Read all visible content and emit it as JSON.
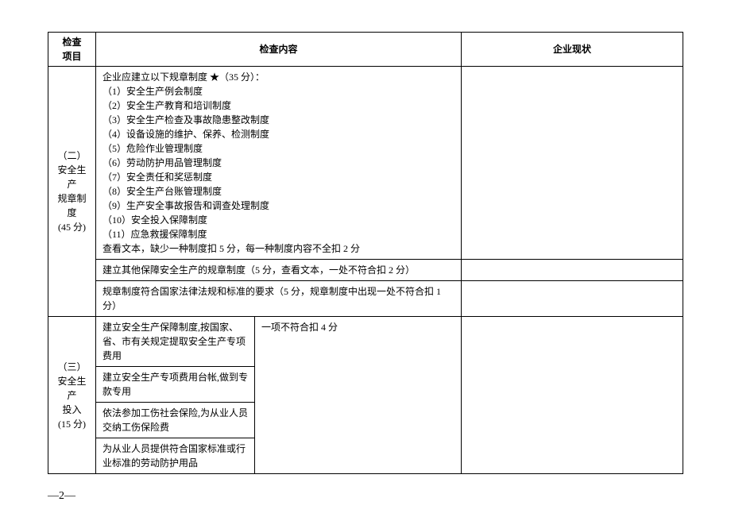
{
  "headers": {
    "col1": "检查\n项目",
    "col2": "检查内容",
    "col3": "企业现状"
  },
  "section2": {
    "category": "（二）\n安全生产\n规章制度\n(45 分)",
    "row1": {
      "intro": "企业应建立以下规章制度 ★（35 分）：",
      "items": [
        "（1）安全生产例会制度",
        "（2）安全生产教育和培训制度",
        "（3）安全生产检查及事故隐患整改制度",
        "（4）设备设施的维护、保养、检测制度",
        "（5）危险作业管理制度",
        "（6）劳动防护用品管理制度",
        "（7）安全责任和奖惩制度",
        "（8）安全生产台账管理制度",
        "（9）生产安全事故报告和调查处理制度",
        "（10）安全投入保障制度",
        "（11）应急救援保障制度"
      ],
      "note": "查看文本，缺少一种制度扣 5 分，每一种制度内容不全扣 2 分"
    },
    "row2": "建立其他保障安全生产的规章制度（5 分，查看文本，一处不符合扣 2 分）",
    "row3": "规章制度符合国家法律法规和标准的要求（5 分，规章制度中出现一处不符合扣 1 分）"
  },
  "section3": {
    "category": "（三）\n安全生产\n投入\n(15 分)",
    "deduct_note": "一项不符合扣 4 分",
    "rows": [
      "建立安全生产保障制度,按国家、省、市有关规定提取安全生产专项费用",
      "建立安全生产专项费用台帐,做到专款专用",
      "依法参加工伤社会保险,为从业人员交纳工伤保险费",
      "为从业人员提供符合国家标准或行业标准的劳动防护用品"
    ]
  },
  "page_number": "—2—"
}
